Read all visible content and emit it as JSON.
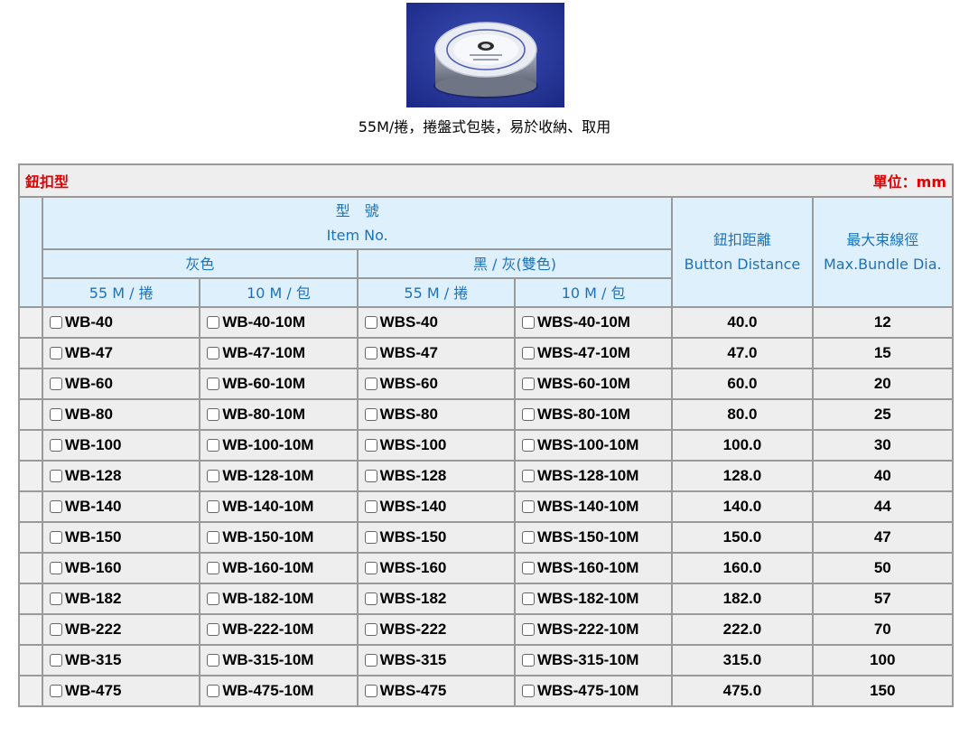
{
  "caption": "55M/捲，捲盤式包裝，易於收納、取用",
  "table": {
    "title_left": "鈕扣型",
    "title_right": "單位：mm",
    "header": {
      "model_zh": "型　號",
      "model_en": "Item No.",
      "group_gray": "灰色",
      "group_black_gray": "黑 / 灰(雙色)",
      "sub_55m_gray": "55 M / 捲",
      "sub_10m_gray": "10 M / 包",
      "sub_55m_bg": "55 M / 捲",
      "sub_10m_bg": "10 M / 包",
      "distance_zh": "鈕扣距離",
      "distance_en": "Button Distance",
      "bundle_zh": "最大束線徑",
      "bundle_en": "Max.Bundle Dia."
    },
    "rows": [
      {
        "c1": "WB-40",
        "c2": "WB-40-10M",
        "c3": "WBS-40",
        "c4": "WBS-40-10M",
        "dist": "40.0",
        "dia": "12"
      },
      {
        "c1": "WB-47",
        "c2": "WB-47-10M",
        "c3": "WBS-47",
        "c4": "WBS-47-10M",
        "dist": "47.0",
        "dia": "15"
      },
      {
        "c1": "WB-60",
        "c2": "WB-60-10M",
        "c3": "WBS-60",
        "c4": "WBS-60-10M",
        "dist": "60.0",
        "dia": "20"
      },
      {
        "c1": "WB-80",
        "c2": "WB-80-10M",
        "c3": "WBS-80",
        "c4": "WBS-80-10M",
        "dist": "80.0",
        "dia": "25"
      },
      {
        "c1": "WB-100",
        "c2": "WB-100-10M",
        "c3": "WBS-100",
        "c4": "WBS-100-10M",
        "dist": "100.0",
        "dia": "30"
      },
      {
        "c1": "WB-128",
        "c2": "WB-128-10M",
        "c3": "WBS-128",
        "c4": "WBS-128-10M",
        "dist": "128.0",
        "dia": "40"
      },
      {
        "c1": "WB-140",
        "c2": "WB-140-10M",
        "c3": "WBS-140",
        "c4": "WBS-140-10M",
        "dist": "140.0",
        "dia": "44"
      },
      {
        "c1": "WB-150",
        "c2": "WB-150-10M",
        "c3": "WBS-150",
        "c4": "WBS-150-10M",
        "dist": "150.0",
        "dia": "47"
      },
      {
        "c1": "WB-160",
        "c2": "WB-160-10M",
        "c3": "WBS-160",
        "c4": "WBS-160-10M",
        "dist": "160.0",
        "dia": "50"
      },
      {
        "c1": "WB-182",
        "c2": "WB-182-10M",
        "c3": "WBS-182",
        "c4": "WBS-182-10M",
        "dist": "182.0",
        "dia": "57"
      },
      {
        "c1": "WB-222",
        "c2": "WB-222-10M",
        "c3": "WBS-222",
        "c4": "WBS-222-10M",
        "dist": "222.0",
        "dia": "70"
      },
      {
        "c1": "WB-315",
        "c2": "WB-315-10M",
        "c3": "WBS-315",
        "c4": "WBS-315-10M",
        "dist": "315.0",
        "dia": "100"
      },
      {
        "c1": "WB-475",
        "c2": "WB-475-10M",
        "c3": "WBS-475",
        "c4": "WBS-475-10M",
        "dist": "475.0",
        "dia": "150"
      }
    ]
  },
  "colors": {
    "title_red": "#e00000",
    "header_blue": "#1d72b8",
    "header_bg": "#dff0fd",
    "row_bg": "#eeeeee"
  },
  "icons": {
    "product": "wire-wrap-spool-icon",
    "checkbox": "checkbox-icon"
  }
}
